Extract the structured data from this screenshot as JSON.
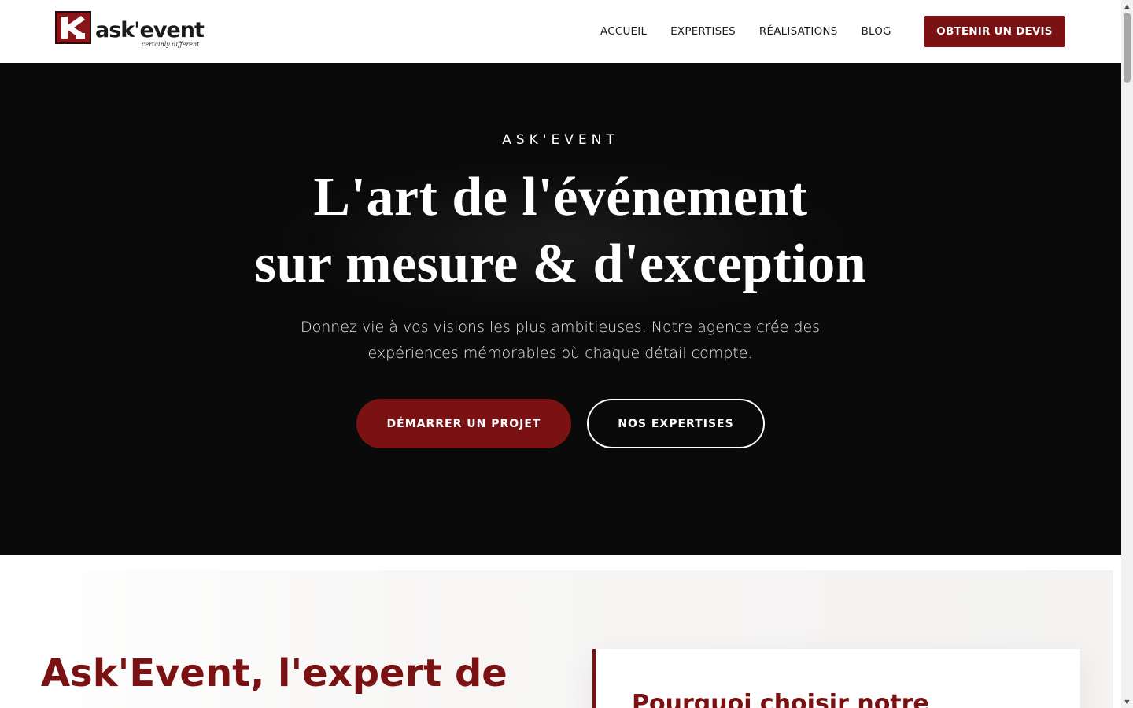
{
  "header": {
    "logo": {
      "wordmark": "ask'event",
      "tagline": "certainly different",
      "brand_color": "#8a1518"
    },
    "nav": [
      {
        "label": "ACCUEIL"
      },
      {
        "label": "EXPERTISES"
      },
      {
        "label": "RÉALISATIONS"
      },
      {
        "label": "BLOG"
      }
    ],
    "cta_label": "OBTENIR UN DEVIS"
  },
  "hero": {
    "eyebrow": "ASK'EVENT",
    "title_line1": "L'art de l'événement",
    "title_line2": "sur mesure & d'exception",
    "subtitle": "Donnez vie à vos visions les plus ambitieuses. Notre agence crée des expériences mémorables où chaque détail compte.",
    "primary_button": "DÉMARRER UN PROJET",
    "secondary_button": "NOS EXPERTISES",
    "background_color": "#0a0a0a"
  },
  "about": {
    "title": "Ask'Event, l'expert de",
    "card_title": "Pourquoi choisir notre"
  },
  "colors": {
    "accent": "#7a1214",
    "text_dark": "#1b1b1b"
  },
  "icons": {
    "logo_mark": "ak-monogram-icon",
    "scroll_up": "arrow-up-icon",
    "scroll_down": "arrow-down-icon"
  }
}
